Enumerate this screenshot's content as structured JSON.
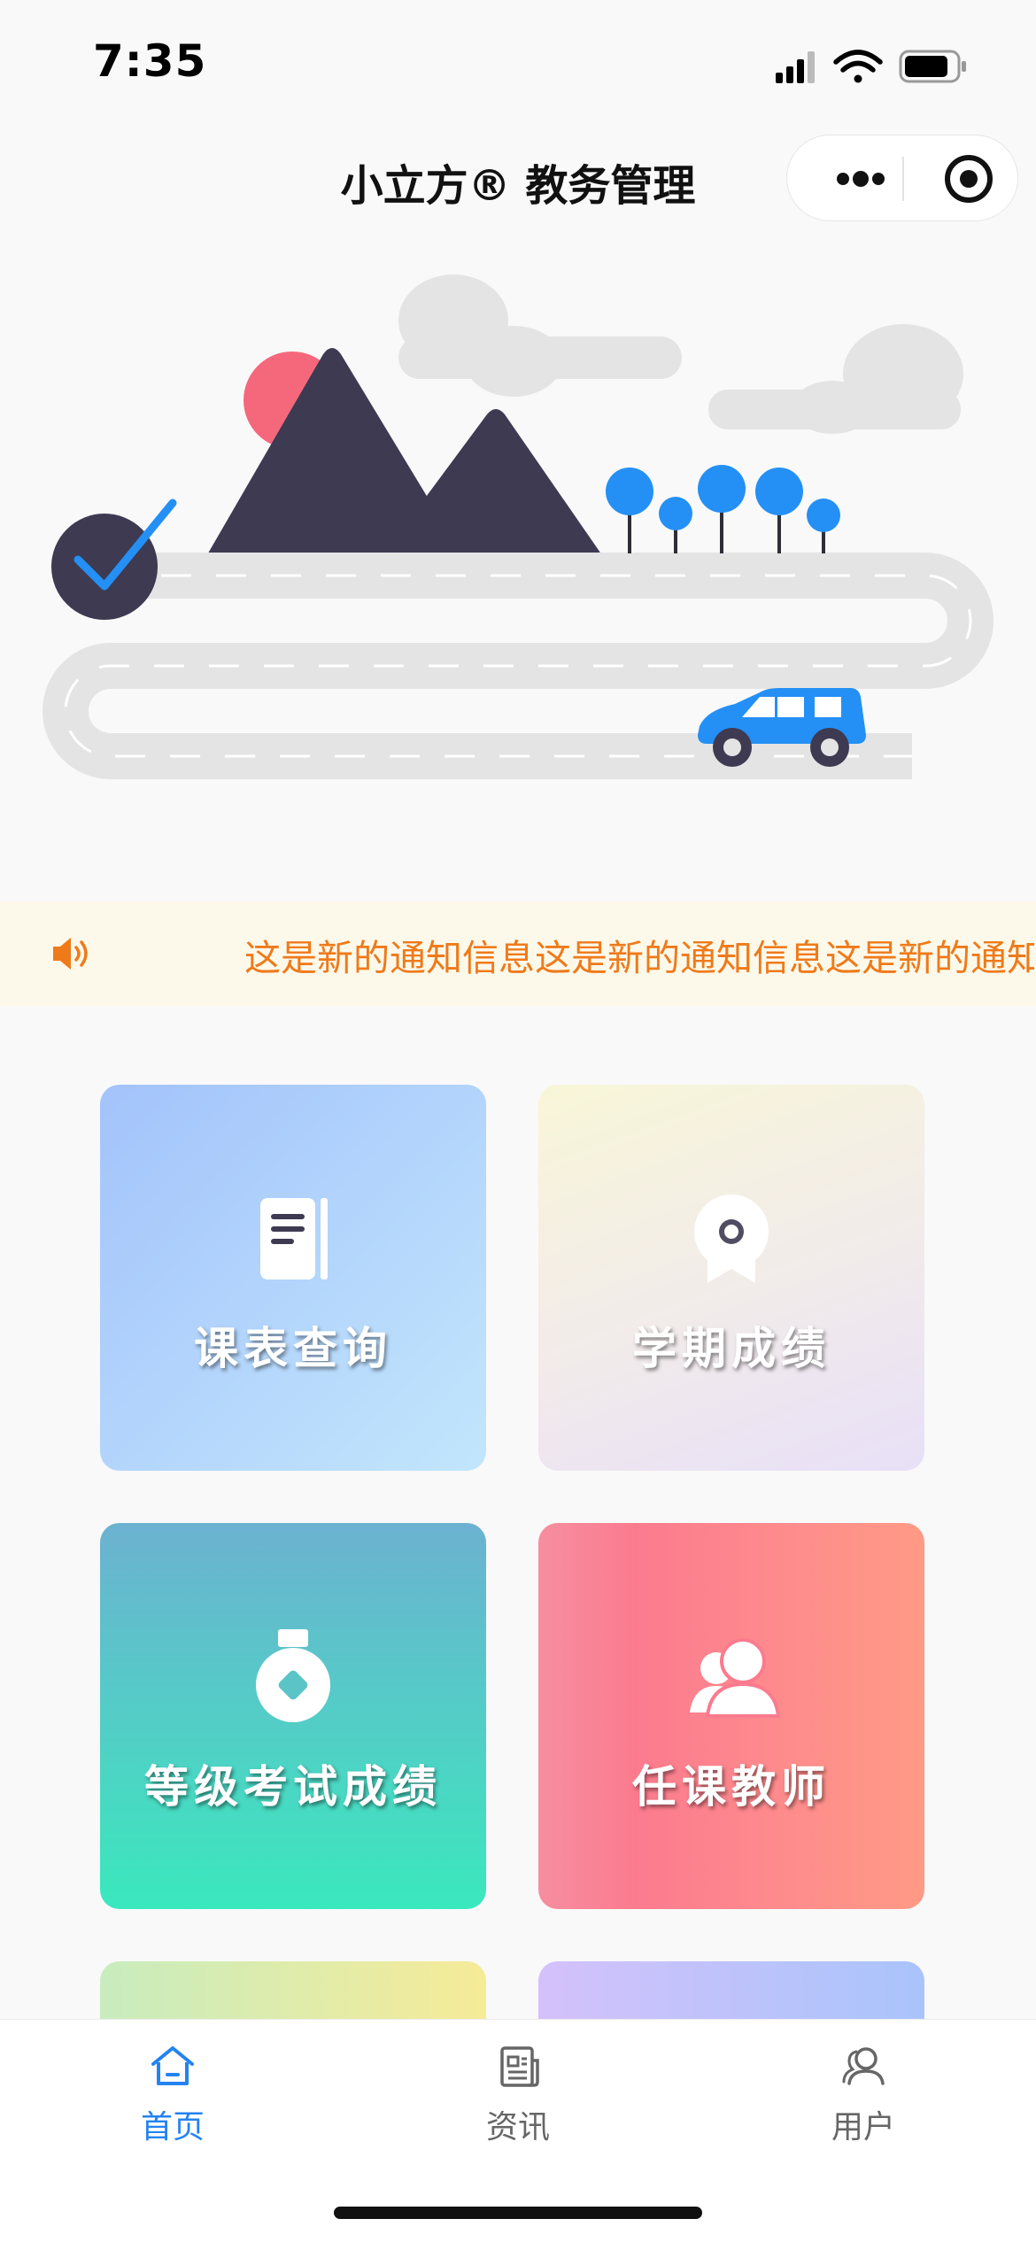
{
  "status_bar": {
    "time": "7:35",
    "battery_level": 0.85
  },
  "nav": {
    "title": "小立方® 教务管理"
  },
  "notice": {
    "text": "这是新的通知信息这是新的通知信息这是新的通知信息这是新的通知信息"
  },
  "tiles": [
    {
      "label": "课表查询",
      "icon": "notebook-icon"
    },
    {
      "label": "学期成绩",
      "icon": "award-badge-icon"
    },
    {
      "label": "等级考试成绩",
      "icon": "medal-icon"
    },
    {
      "label": "任课教师",
      "icon": "teachers-icon"
    }
  ],
  "tabbar": {
    "items": [
      {
        "label": "首页",
        "icon": "home-icon",
        "active": true
      },
      {
        "label": "资讯",
        "icon": "news-icon",
        "active": false
      },
      {
        "label": "用户",
        "icon": "user-icon",
        "active": false
      }
    ]
  },
  "colors": {
    "accent": "#2483f0",
    "notice_text": "#ef7a1a",
    "notice_bg": "#fdf9ea"
  }
}
